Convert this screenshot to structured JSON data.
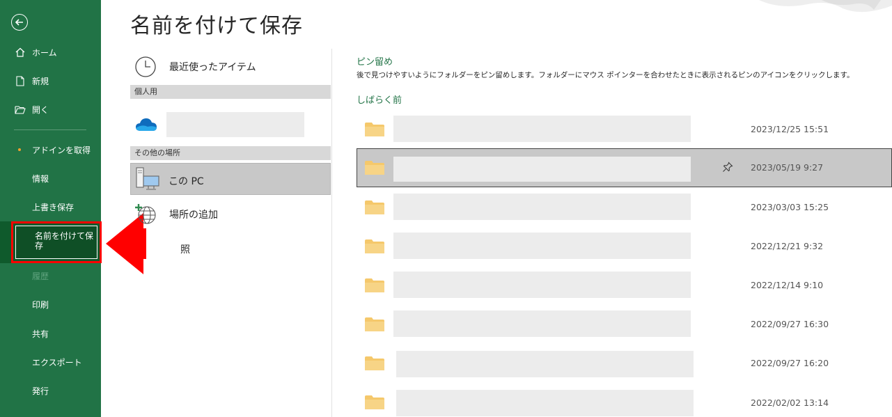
{
  "page": {
    "title": "名前を付けて保存"
  },
  "sidebar": {
    "items": [
      {
        "label": "ホーム"
      },
      {
        "label": "新規"
      },
      {
        "label": "開く"
      },
      {
        "label": "アドインを取得"
      },
      {
        "label": "情報"
      },
      {
        "label": "上書き保存"
      },
      {
        "label": "名前を付けて保存"
      },
      {
        "label": "履歴"
      },
      {
        "label": "印刷"
      },
      {
        "label": "共有"
      },
      {
        "label": "エクスポート"
      },
      {
        "label": "発行"
      }
    ]
  },
  "locations": {
    "recent": "最近使ったアイテム",
    "personal_header": "個人用",
    "other_header": "その他の場所",
    "this_pc": "この PC",
    "add_place": "場所の追加",
    "browse_partial": "照"
  },
  "pinned": {
    "title": "ピン留め",
    "description": "後で見つけやすいようにフォルダーをピン留めします。フォルダーにマウス ポインターを合わせたときに表示されるピンのアイコンをクリックします。"
  },
  "recent": {
    "title": "しばらく前",
    "rows": [
      {
        "date": "2023/12/25 15:51"
      },
      {
        "date": "2023/05/19 9:27"
      },
      {
        "date": "2023/03/03 15:25"
      },
      {
        "date": "2022/12/21 9:32"
      },
      {
        "date": "2022/12/14 9:10"
      },
      {
        "date": "2022/09/27 16:30"
      },
      {
        "date": "2022/09/27 16:20"
      },
      {
        "date": "2022/02/02 13:14"
      }
    ]
  },
  "colors": {
    "brand": "#217346",
    "highlight": "#ff0000",
    "folder": "#f5c86b"
  }
}
